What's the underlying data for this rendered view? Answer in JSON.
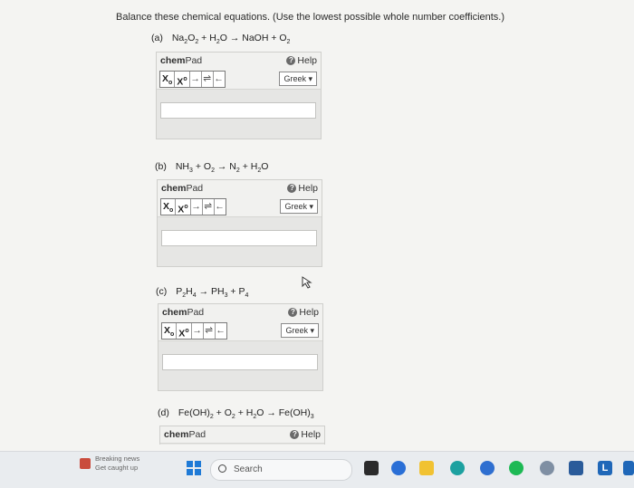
{
  "instruction": "Balance these chemical equations. (Use the lowest possible whole number coefficients.)",
  "parts": [
    {
      "label": "(a)",
      "equation_html": "Na<sub>2</sub>O<sub>2</sub> + H<sub>2</sub>O → NaOH + O<sub>2</sub>"
    },
    {
      "label": "(b)",
      "equation_html": "NH<sub>3</sub> + O<sub>2</sub> → N<sub>2</sub> + H<sub>2</sub>O"
    },
    {
      "label": "(c)",
      "equation_html": "P<sub>2</sub>H<sub>4</sub> → PH<sub>3</sub> + P<sub>4</sub>"
    },
    {
      "label": "(d)",
      "equation_html": "Fe(OH)<sub>2</sub> + O<sub>2</sub> + H<sub>2</sub>O → Fe(OH)<sub>3</sub>"
    }
  ],
  "chempad": {
    "title_bold": "chem",
    "title_rest": "Pad",
    "help": "Help",
    "subscript_btn": "X",
    "subscript_mark": "o",
    "superscript_btn": "X",
    "superscript_mark": "o",
    "arrow_btn": "→",
    "equilibrium_btn": "⇌",
    "back_btn": "←",
    "greek": "Greek ▾",
    "input_value": ""
  },
  "taskbar": {
    "news_line1": "Breaking news",
    "news_line2": "Get caught up",
    "search": "Search"
  },
  "colors": {
    "accent_blue": "#1f7ad6",
    "panel": "#e6e6e4"
  }
}
